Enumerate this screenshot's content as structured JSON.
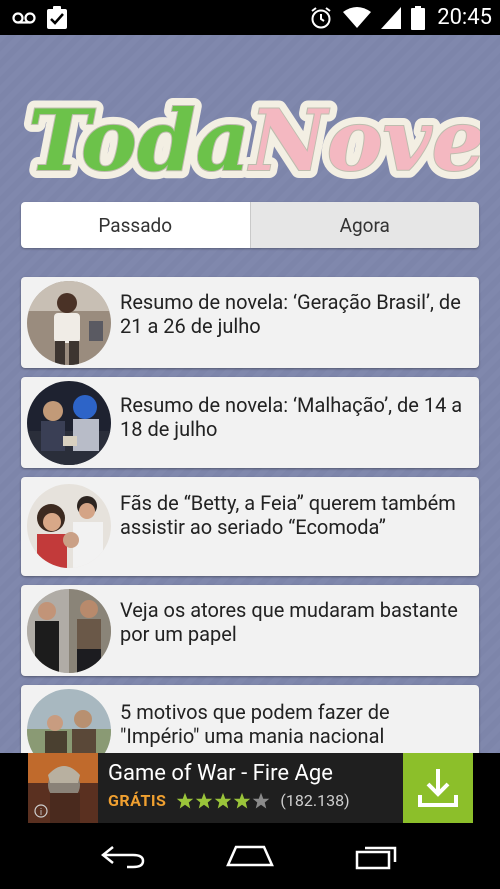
{
  "status_bar": {
    "time": "20:45",
    "icons": [
      "voicemail-icon",
      "clipboard-check-icon",
      "alarm-icon",
      "wifi-icon",
      "signal-icon",
      "battery-icon"
    ]
  },
  "app": {
    "logo": {
      "part1": "Toda",
      "part2": "Novela",
      "colors": {
        "part1": "#6cc24a",
        "part2": "#f4b8c1"
      }
    },
    "tabs": [
      {
        "label": "Passado",
        "active": true
      },
      {
        "label": "Agora",
        "active": false
      }
    ],
    "articles": [
      {
        "title": "Resumo de novela: ‘Geração Brasil’, de 21 a 26 de julho"
      },
      {
        "title": "Resumo de novela: ‘Malhação’, de 14 a 18 de julho"
      },
      {
        "title": "Fãs de “Betty, a Feia” querem também assistir ao seriado “Ecomoda”"
      },
      {
        "title": "Veja os atores que mudaram bastante por um papel"
      },
      {
        "title": "5 motivos que podem fazer de \"Império\" uma mania nacional"
      }
    ]
  },
  "ad": {
    "title": "Game of War - Fire Age",
    "price": "GRÁTIS",
    "rating": 4,
    "rating_max": 5,
    "reviews": "(182.138)",
    "colors": {
      "accent": "#8cbf2a",
      "price": "#f0a030"
    }
  },
  "nav_bar": {
    "buttons": [
      "back-icon",
      "home-icon",
      "recents-icon"
    ]
  }
}
